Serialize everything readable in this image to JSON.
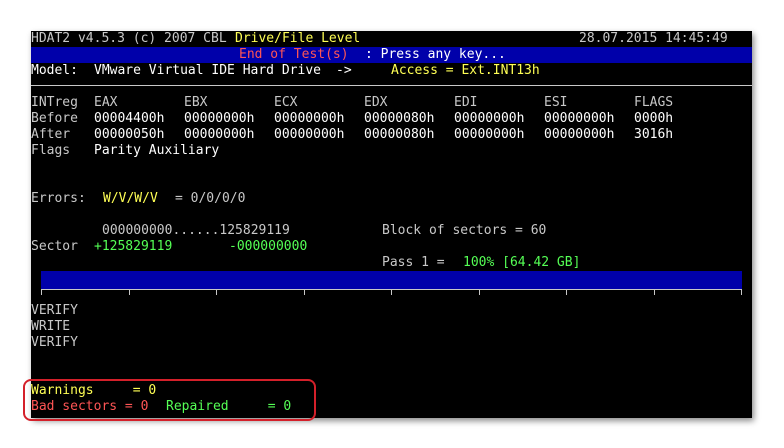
{
  "header": {
    "app_title": "HDAT2 v4.5.3 (c) 2007 CBL",
    "level": "Drive/File Level",
    "datetime": "28.07.2015 14:45:49"
  },
  "status_bar": {
    "message_red": "End of Test(s)",
    "message_rest": ": Press any key..."
  },
  "model": {
    "label": "Model:",
    "name": "VMware Virtual IDE Hard Drive",
    "arrow": "->",
    "access": "Access = Ext.INT13h"
  },
  "registers": {
    "columns": [
      "INTreg",
      "EAX",
      "EBX",
      "ECX",
      "EDX",
      "EDI",
      "ESI",
      "FLAGS"
    ],
    "rows": [
      [
        "Before",
        "00004400h",
        "00000000h",
        "00000000h",
        "00000080h",
        "00000000h",
        "00000000h",
        "0000h"
      ],
      [
        "After",
        "00000050h",
        "00000000h",
        "00000000h",
        "00000080h",
        "00000000h",
        "00000000h",
        "3016h"
      ]
    ],
    "flags_label": "Flags",
    "flags_value": "Parity Auxiliary"
  },
  "errors": {
    "label": "Errors:",
    "codes": "W/V/W/V",
    "values": "= 0/0/0/0"
  },
  "sectors": {
    "range": "000000000......125829119",
    "block_text": "Block of sectors = 60",
    "sector_label": "Sector",
    "sector_current": "+125829119",
    "sector_remaining": "-000000000",
    "pass_label": "Pass 1 =",
    "pass_value": "100% [64.42 GB]",
    "progress": 1.0
  },
  "log": [
    "VERIFY",
    "WRITE",
    "VERIFY"
  ],
  "summary": {
    "warnings": "Warnings     = 0",
    "bad_sectors": "Bad sectors = 0",
    "repaired": "Repaired     = 0"
  },
  "colors": {
    "background": "#000000",
    "status_bar": "#0000aa",
    "highlight_border": "#d4202a",
    "yellow": "#ffff55",
    "red": "#ff5555",
    "green": "#55ff55"
  }
}
